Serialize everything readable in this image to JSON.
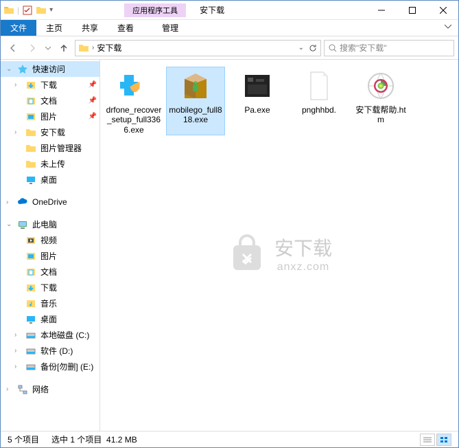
{
  "titlebar": {
    "context_tab": "应用程序工具",
    "window_title": "安下载"
  },
  "ribbon": {
    "file": "文件",
    "home": "主页",
    "share": "共享",
    "view": "查看",
    "manage": "管理"
  },
  "nav": {
    "breadcrumb": "安下载",
    "search_placeholder": "搜索\"安下载\""
  },
  "sidebar": {
    "quick_access": "快速访问",
    "items_quick": [
      {
        "label": "下载",
        "pinned": true,
        "icon": "download"
      },
      {
        "label": "文档",
        "pinned": true,
        "icon": "doc"
      },
      {
        "label": "图片",
        "pinned": true,
        "icon": "pic"
      },
      {
        "label": "安下载",
        "pinned": false,
        "icon": "folder"
      },
      {
        "label": "图片管理器",
        "pinned": false,
        "icon": "folder"
      },
      {
        "label": "未上传",
        "pinned": false,
        "icon": "folder"
      },
      {
        "label": "桌面",
        "pinned": false,
        "icon": "desktop"
      }
    ],
    "onedrive": "OneDrive",
    "this_pc": "此电脑",
    "items_pc": [
      {
        "label": "视频",
        "icon": "video"
      },
      {
        "label": "图片",
        "icon": "pic"
      },
      {
        "label": "文档",
        "icon": "doc"
      },
      {
        "label": "下载",
        "icon": "download"
      },
      {
        "label": "音乐",
        "icon": "music"
      },
      {
        "label": "桌面",
        "icon": "desktop"
      },
      {
        "label": "本地磁盘 (C:)",
        "icon": "disk"
      },
      {
        "label": "软件 (D:)",
        "icon": "disk"
      },
      {
        "label": "备份[勿删] (E:)",
        "icon": "disk"
      }
    ],
    "network": "网络"
  },
  "files": [
    {
      "name": "drfone_recover_setup_full3366.exe",
      "type": "exe-shield"
    },
    {
      "name": "mobilego_full818.exe",
      "type": "box",
      "selected": true
    },
    {
      "name": "Pa.exe",
      "type": "dark-exe"
    },
    {
      "name": "pnghhbd.",
      "type": "blank"
    },
    {
      "name": "安下载帮助.htm",
      "type": "htm"
    }
  ],
  "watermark": {
    "text": "安下载",
    "sub": "anxz.com"
  },
  "status": {
    "count": "5 个项目",
    "selected": "选中 1 个项目",
    "size": "41.2 MB"
  }
}
